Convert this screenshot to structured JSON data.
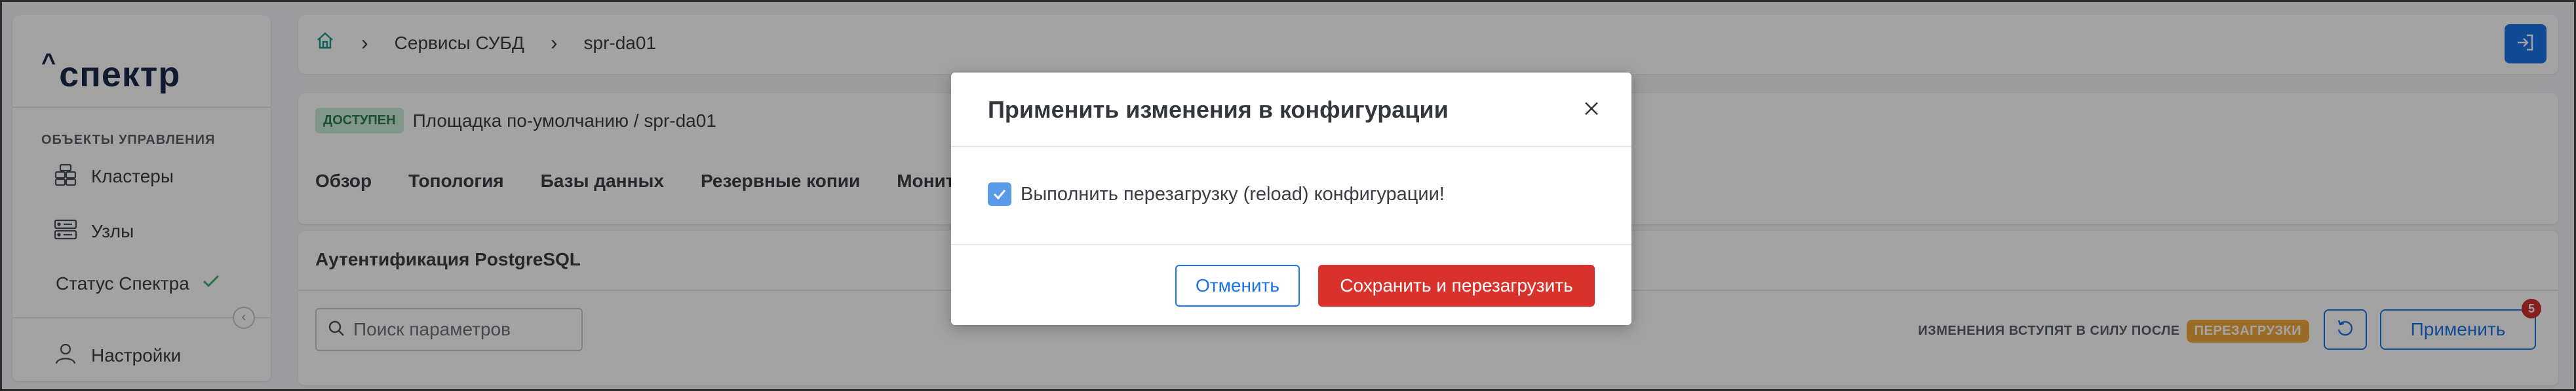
{
  "app": {
    "logo_text": "спектр",
    "logo_caret": "^"
  },
  "sidebar": {
    "section_title": "ОБЪЕКТЫ УПРАВЛЕНИЯ",
    "items": [
      {
        "label": "Кластеры",
        "icon": "clusters-icon"
      },
      {
        "label": "Узлы",
        "icon": "servers-icon"
      }
    ],
    "status_label": "Статус Спектра",
    "settings_label": "Настройки"
  },
  "breadcrumb": {
    "items": [
      "Сервисы СУБД",
      "spr-da01"
    ],
    "home_icon": "home-icon"
  },
  "header": {
    "status_badge": "ДОСТУПЕН",
    "location_path": "Площадка по-умолчанию /  spr-da01"
  },
  "tabs": [
    {
      "label": "Обзор"
    },
    {
      "label": "Топология"
    },
    {
      "label": "Базы данных"
    },
    {
      "label": "Резервные копии"
    },
    {
      "label": "Монито"
    }
  ],
  "params": {
    "title": "Аутентификация PostgreSQL",
    "search_placeholder": "Поиск параметров",
    "restart_note": "ИЗМЕНЕНИЯ ВСТУПЯТ В СИЛУ ПОСЛЕ",
    "restart_badge": "ПЕРЕЗАГРУЗКИ",
    "apply_label": "Применить",
    "apply_count": "5"
  },
  "modal": {
    "title": "Применить изменения в конфигурации",
    "checkbox_label": "Выполнить перезагрузку (reload) конфигурации!",
    "checkbox_checked": true,
    "cancel_label": "Отменить",
    "confirm_label": "Сохранить и перезагрузить"
  },
  "colors": {
    "accent": "#1a73e8",
    "danger": "#d9312b",
    "warning": "#f2a93b",
    "success_bg": "#c8ecd4"
  }
}
